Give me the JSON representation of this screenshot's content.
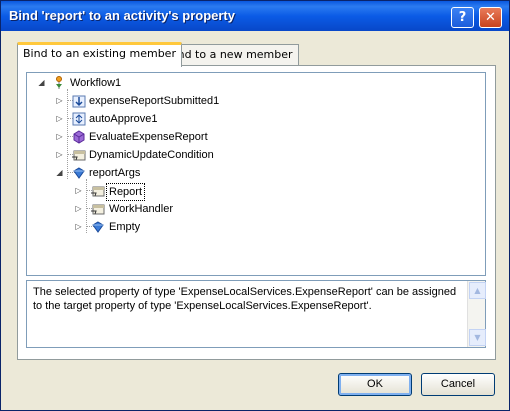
{
  "window": {
    "title": "Bind 'report' to an activity's property"
  },
  "titlebar": {
    "help_label": "?",
    "close_label": "✕"
  },
  "tabs": [
    {
      "label": "Bind to an existing member",
      "active": true
    },
    {
      "label": "Bind to a new member",
      "active": false
    }
  ],
  "tree": {
    "root": {
      "label": "Workflow1",
      "icon": "workflow-icon"
    },
    "items": [
      {
        "label": "expenseReportSubmitted1",
        "icon": "event-activity-icon"
      },
      {
        "label": "autoApprove1",
        "icon": "activity-icon"
      },
      {
        "label": "EvaluateExpenseReport",
        "icon": "method-icon"
      },
      {
        "label": "DynamicUpdateCondition",
        "icon": "property-icon"
      },
      {
        "label": "reportArgs",
        "icon": "field-icon"
      }
    ],
    "children": [
      {
        "label": "Report",
        "icon": "property-icon",
        "selected": true
      },
      {
        "label": "WorkHandler",
        "icon": "property-icon"
      },
      {
        "label": "Empty",
        "icon": "field-icon"
      }
    ]
  },
  "description": "The selected property of type 'ExpenseLocalServices.ExpenseReport' can be assigned to the target property of type 'ExpenseLocalServices.ExpenseReport'.",
  "buttons": {
    "ok": "OK",
    "cancel": "Cancel"
  },
  "colors": {
    "titlebar": "#0a58e0",
    "dialog": "#ece9d8",
    "active_tab_accent": "#ffc83c"
  }
}
